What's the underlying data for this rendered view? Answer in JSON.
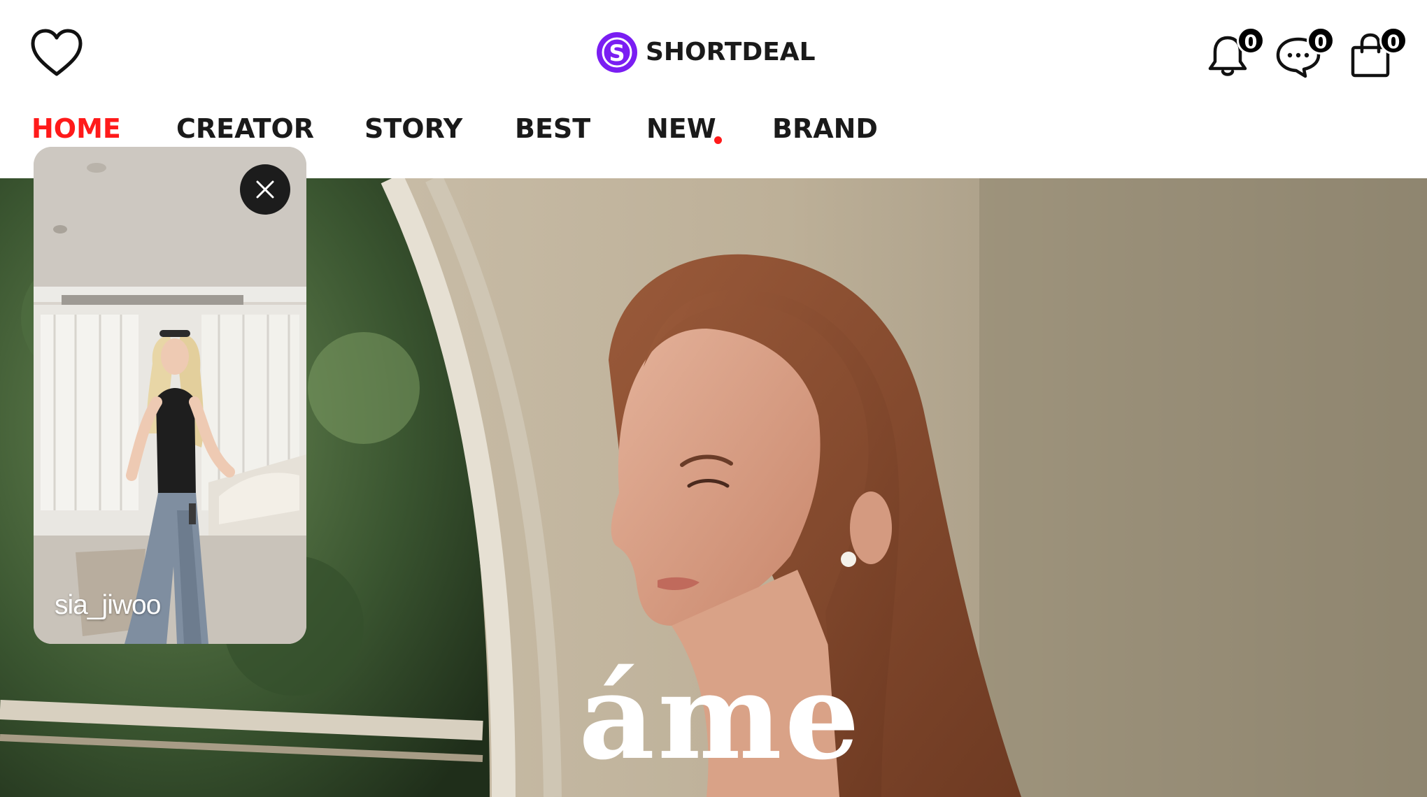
{
  "header": {
    "logo_text": "SHORTDEAL",
    "logo_mark": "S",
    "logo_color": "#7a1ef2",
    "wishlist_icon": "heart-outline-icon",
    "notifications": {
      "icon": "bell-icon",
      "count": "0"
    },
    "messages": {
      "icon": "chat-bubble-icon",
      "count": "0"
    },
    "cart": {
      "icon": "shopping-bag-icon",
      "count": "0"
    }
  },
  "nav": {
    "active_color": "#ff1a1a",
    "tabs": [
      {
        "label": "HOME",
        "active": true
      },
      {
        "label": "CREATOR",
        "active": false
      },
      {
        "label": "STORY",
        "active": false
      },
      {
        "label": "BEST",
        "active": false
      },
      {
        "label": "NEW",
        "active": false,
        "new_indicator": true
      },
      {
        "label": "BRAND",
        "active": false
      }
    ]
  },
  "hero": {
    "brand_name": "áme"
  },
  "mini_player": {
    "creator": "sia_jiwoo",
    "close_icon": "close-icon"
  }
}
